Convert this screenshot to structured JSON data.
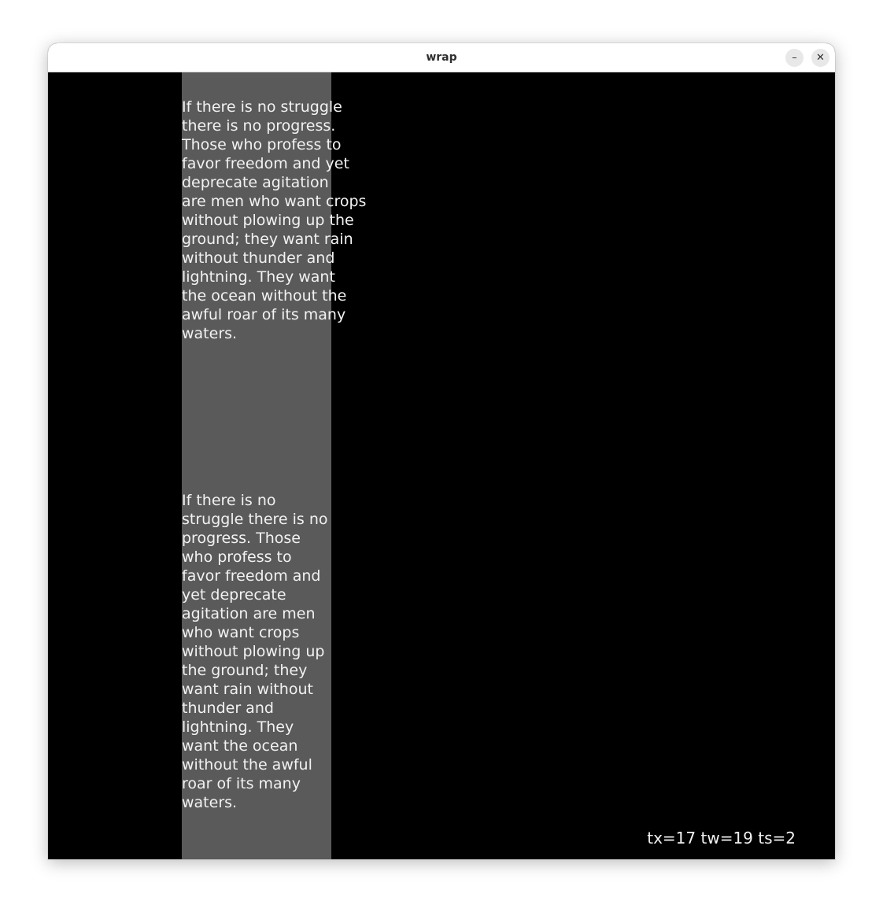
{
  "window": {
    "title": "wrap",
    "minimize_glyph": "–",
    "close_glyph": "✕"
  },
  "icons": {
    "minimize": "minimize-icon",
    "close": "close-icon"
  },
  "colors": {
    "background": "#000000",
    "column": "#5a5a5a",
    "text": "#f2f2f2"
  },
  "paragraphs": [
    {
      "text": "If there is no struggle\nthere is no progress.\nThose who profess to\nfavor freedom and yet\ndeprecate agitation\nare men who want crops\nwithout plowing up the\nground; they want rain\nwithout thunder and\nlightning. They want\nthe ocean without the\nawful roar of its many\nwaters."
    },
    {
      "text": "If there is no\nstruggle there is no\nprogress. Those\nwho profess to\nfavor freedom and\nyet deprecate\nagitation are men\nwho want crops\nwithout plowing up\nthe ground; they\nwant rain without\nthunder and\nlightning. They\nwant the ocean\nwithout the awful\nroar of its many\nwaters."
    }
  ],
  "status": {
    "text": "tx=17 tw=19 ts=2"
  }
}
